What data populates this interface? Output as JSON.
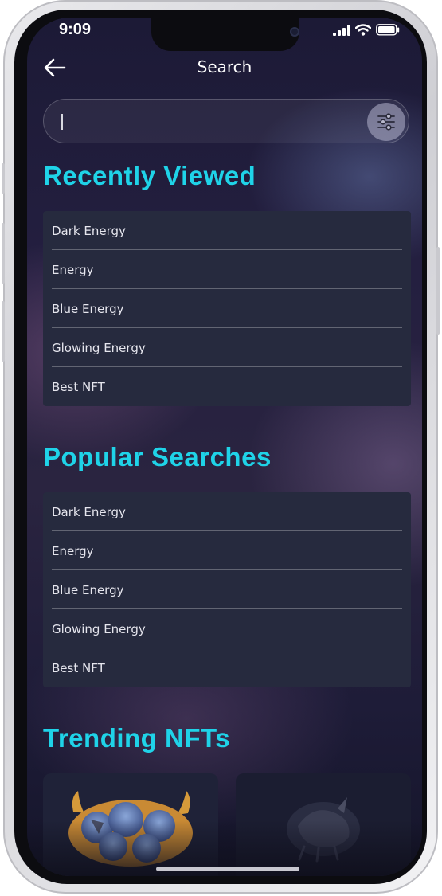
{
  "status_bar": {
    "time": "9:09",
    "icons": [
      "signal-icon",
      "wifi-icon",
      "battery-icon"
    ]
  },
  "header": {
    "title": "Search",
    "back_icon": "arrow-left-icon"
  },
  "search": {
    "value": "",
    "placeholder": "",
    "filter_icon": "sliders-icon"
  },
  "recently_viewed": {
    "title": "Recently Viewed",
    "items": [
      {
        "label": "Dark Energy"
      },
      {
        "label": "Energy"
      },
      {
        "label": "Blue Energy"
      },
      {
        "label": "Glowing Energy"
      },
      {
        "label": "Best NFT"
      }
    ]
  },
  "popular_searches": {
    "title": "Popular Searches",
    "items": [
      {
        "label": "Dark Energy"
      },
      {
        "label": "Energy"
      },
      {
        "label": "Blue Energy"
      },
      {
        "label": "Glowing Energy"
      },
      {
        "label": "Best NFT"
      }
    ]
  },
  "trending": {
    "title": "Trending NFTs"
  },
  "colors": {
    "accent": "#1fd3e8",
    "card_background": "#262a3e",
    "text": "#e6e6ee"
  }
}
